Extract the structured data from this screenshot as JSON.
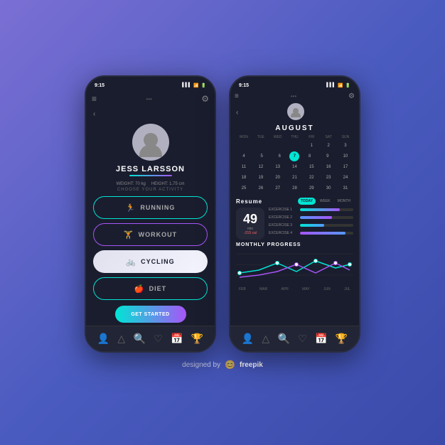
{
  "page": {
    "background": "linear-gradient(135deg, #7b6fd4, #3a4aaa)",
    "designed_by": "designed by",
    "freepik": "freepik"
  },
  "phone1": {
    "status": {
      "time": "9:15",
      "wifi": true,
      "battery": true
    },
    "header": {
      "menu_label": "≡",
      "settings_label": "⚙"
    },
    "user": {
      "name": "JESS LARSSON",
      "weight": "WEIGHT: 70 kg",
      "height": "HEIGHT: 1.75 cm"
    },
    "choose_label": "CHOOSE YOUR ACTIVITY",
    "activities": [
      {
        "id": "running",
        "label": "RUNNING",
        "icon": "🏃"
      },
      {
        "id": "workout",
        "label": "WORKOUT",
        "icon": "🏋"
      },
      {
        "id": "cycling",
        "label": "CYCLING",
        "icon": "🚲",
        "active": true
      },
      {
        "id": "diet",
        "label": "DIET",
        "icon": "🍎"
      }
    ],
    "cta_label": "GET STARTED",
    "nav_items": [
      {
        "id": "profile",
        "icon": "👤",
        "active": true
      },
      {
        "id": "activity",
        "icon": "△"
      },
      {
        "id": "search",
        "icon": "🔍"
      },
      {
        "id": "heart",
        "icon": "♡"
      },
      {
        "id": "calendar",
        "icon": "📅"
      },
      {
        "id": "trophy",
        "icon": "🏆"
      }
    ]
  },
  "phone2": {
    "status": {
      "time": "9:15"
    },
    "month": "AUGUST",
    "calendar": {
      "day_names": [
        "MON",
        "TUE",
        "WED",
        "THU",
        "FRI",
        "SAT",
        "SUN"
      ],
      "weeks": [
        [
          "",
          "",
          "",
          "",
          "1",
          "2",
          "3"
        ],
        [
          "4",
          "5",
          "6",
          "7",
          "8",
          "9",
          "10"
        ],
        [
          "11",
          "12",
          "13",
          "14",
          "15",
          "16",
          "17"
        ],
        [
          "18",
          "19",
          "20",
          "21",
          "22",
          "23",
          "24"
        ],
        [
          "25",
          "26",
          "27",
          "28",
          "29",
          "30",
          "31"
        ]
      ],
      "today": "7"
    },
    "resume": {
      "label": "Resume",
      "tabs": [
        "TODAY",
        "WEEK",
        "MONTH"
      ],
      "active_tab": "TODAY"
    },
    "stats": {
      "value": "49",
      "unit": "min",
      "calories": "-215 cal"
    },
    "exercises": [
      {
        "label": "EXCERCISE 1",
        "progress": 75,
        "color": "#00e5d4"
      },
      {
        "label": "EXCERCISE 2",
        "progress": 60,
        "color": "#a855f7"
      },
      {
        "label": "EXCERCISE 3",
        "progress": 45,
        "color": "#5599ff"
      },
      {
        "label": "EXCERCISE 4",
        "progress": 85,
        "color": "#a855f7"
      }
    ],
    "monthly_progress": {
      "label": "MONTHLY PROGRESS",
      "months": [
        "FEB",
        "MAR",
        "APR",
        "MAY",
        "JUN",
        "JUL"
      ]
    },
    "nav_items": [
      {
        "id": "profile",
        "icon": "👤"
      },
      {
        "id": "activity",
        "icon": "△"
      },
      {
        "id": "search",
        "icon": "🔍"
      },
      {
        "id": "heart",
        "icon": "♡"
      },
      {
        "id": "calendar",
        "icon": "📅"
      },
      {
        "id": "trophy",
        "icon": "🏆"
      }
    ]
  }
}
